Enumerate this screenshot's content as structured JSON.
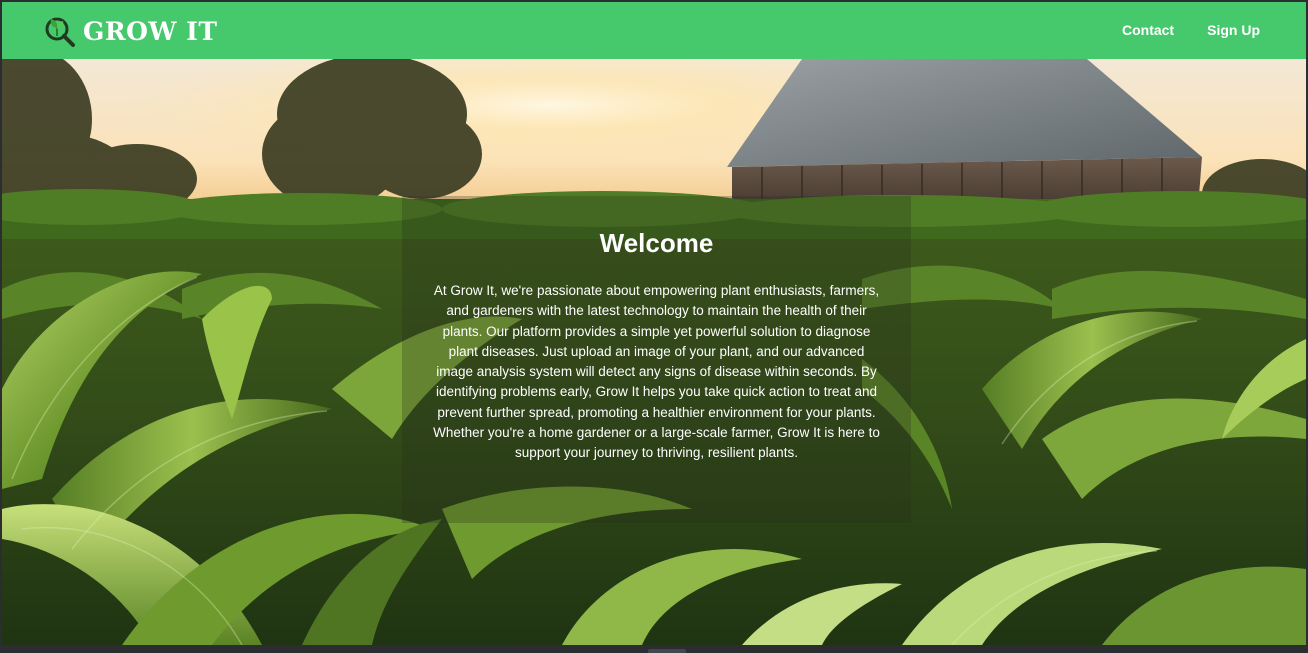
{
  "navbar": {
    "brand": "GROW IT",
    "brand_icon": "plant-magnifier-icon",
    "links": {
      "contact": "Contact",
      "signup": "Sign Up"
    },
    "color": "#46c86d"
  },
  "hero": {
    "background_image": "cornfield-barn-sunset",
    "title": "Welcome",
    "body": "At Grow It, we're passionate about empowering plant enthusiasts, farmers, and gardeners with the latest technology to maintain the health of their plants. Our platform provides a simple yet powerful solution to diagnose plant diseases. Just upload an image of your plant, and our advanced image analysis system will detect any signs of disease within seconds. By identifying problems early, Grow It helps you take quick action to treat and prevent further spread, promoting a healthier environment for your plants. Whether you're a home gardener or a large-scale farmer, Grow It is here to support your journey to thriving, resilient plants."
  }
}
